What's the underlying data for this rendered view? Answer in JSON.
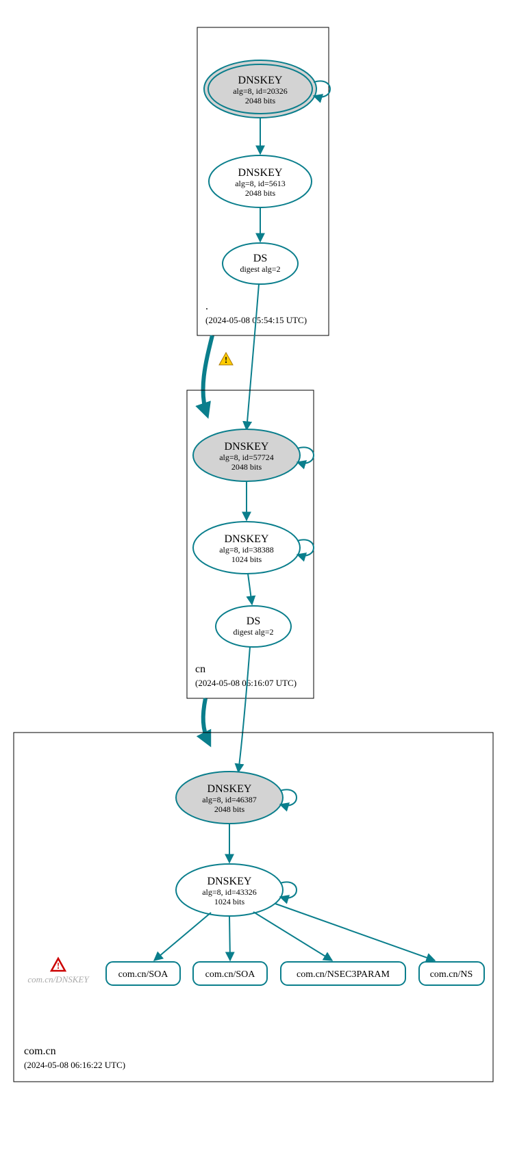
{
  "zones": {
    "root": {
      "label": ".",
      "timestamp": "(2024-05-08 05:54:15 UTC)"
    },
    "cn": {
      "label": "cn",
      "timestamp": "(2024-05-08 06:16:07 UTC)"
    },
    "comcn": {
      "label": "com.cn",
      "timestamp": "(2024-05-08 06:16:22 UTC)"
    }
  },
  "nodes": {
    "root_ksk": {
      "title": "DNSKEY",
      "line2": "alg=8, id=20326",
      "line3": "2048 bits"
    },
    "root_zsk": {
      "title": "DNSKEY",
      "line2": "alg=8, id=5613",
      "line3": "2048 bits"
    },
    "root_ds": {
      "title": "DS",
      "line2": "digest alg=2"
    },
    "cn_ksk": {
      "title": "DNSKEY",
      "line2": "alg=8, id=57724",
      "line3": "2048 bits"
    },
    "cn_zsk": {
      "title": "DNSKEY",
      "line2": "alg=8, id=38388",
      "line3": "1024 bits"
    },
    "cn_ds": {
      "title": "DS",
      "line2": "digest alg=2"
    },
    "comcn_ksk": {
      "title": "DNSKEY",
      "line2": "alg=8, id=46387",
      "line3": "2048 bits"
    },
    "comcn_zsk": {
      "title": "DNSKEY",
      "line2": "alg=8, id=43326",
      "line3": "1024 bits"
    },
    "rr_soa1": {
      "label": "com.cn/SOA"
    },
    "rr_soa2": {
      "label": "com.cn/SOA"
    },
    "rr_nsec3": {
      "label": "com.cn/NSEC3PARAM"
    },
    "rr_ns": {
      "label": "com.cn/NS"
    },
    "faded": {
      "label": "com.cn/DNSKEY"
    }
  }
}
